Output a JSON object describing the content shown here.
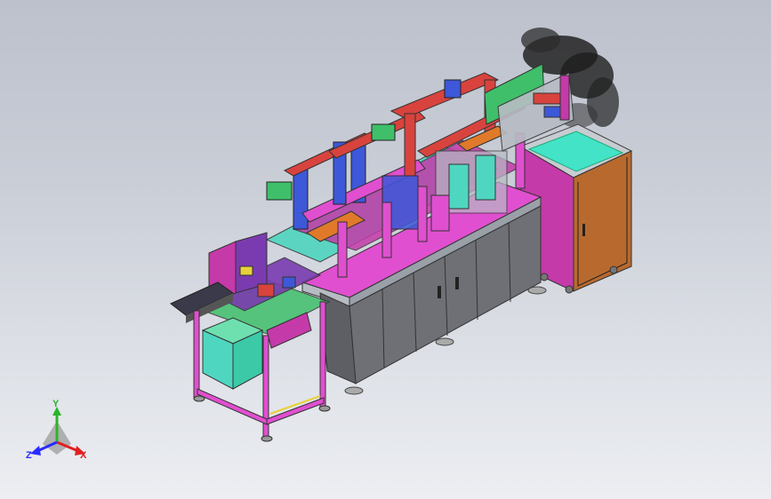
{
  "viewport": {
    "background_top": "#bcc1cc",
    "background_bottom": "#eceef2"
  },
  "model_colors": {
    "cabinet_gray": "#6f7075",
    "frame_pink": "#e04fcf",
    "frame_steel": "#b7bcc4",
    "panel_magenta": "#c43aa9",
    "panel_orange": "#b86a2e",
    "screen_teal": "#43e3c8",
    "gantry_red": "#d8433e",
    "module_green": "#3fbf6a",
    "accent_blue": "#3d58d8",
    "feeder_purple": "#7a3bb0",
    "base_cyan": "#4fd6c0",
    "conveyor_yellow": "#e8d23a",
    "smoke": "#2a2a2a"
  },
  "triad": {
    "x_label": "X",
    "y_label": "Y",
    "z_label": "Z",
    "x_color": "#e02020",
    "y_color": "#2bb52b",
    "z_color": "#2a2aff"
  }
}
